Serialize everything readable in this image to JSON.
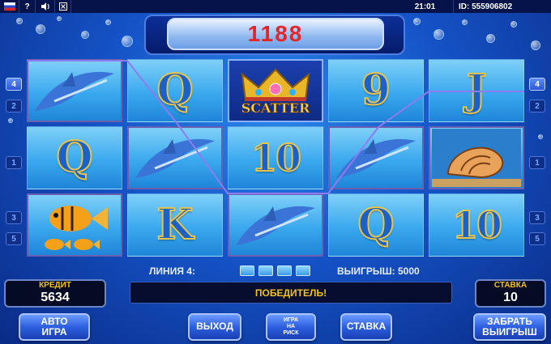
{
  "status_bar": {
    "help": "?",
    "sound_icon": "speaker-icon",
    "time": "21:01",
    "id_label": "ID: 555906802"
  },
  "win_amount": "1188",
  "reels": {
    "columns": [
      [
        "dolphin",
        "Q",
        "fish"
      ],
      [
        "Q",
        "dolphin",
        "K"
      ],
      [
        "scatter",
        "10",
        "dolphin"
      ],
      [
        "9",
        "dolphin",
        "Q"
      ],
      [
        "J",
        "shell",
        "10"
      ]
    ],
    "scatter_label": "SCATTER"
  },
  "line_indicators": {
    "left": [
      "4",
      "2",
      "1",
      "3",
      "5"
    ],
    "right": [
      "4",
      "2",
      "1",
      "3",
      "5"
    ]
  },
  "info": {
    "line_text": "ЛИНИЯ 4:",
    "win_text": "ВЫИГРЫШ: 5000"
  },
  "credit": {
    "label": "КРЕДИТ",
    "value": "5634"
  },
  "bet": {
    "label": "СТАВКА",
    "value": "10"
  },
  "message": "ПОБЕДИТЕЛЬ!",
  "buttons": {
    "auto_line1": "АВТО",
    "auto_line2": "ИГРА",
    "exit": "ВЫХОД",
    "risk_line1": "ИГРА",
    "risk_line2": "НА",
    "risk_line3": "РИСК",
    "bet": "СТАВКА",
    "collect_line1": "ЗАБРАТЬ",
    "collect_line2": "ВЫИГРЫШ"
  },
  "colors": {
    "win_digits": "#e3262b",
    "panel_label": "#f1c21b",
    "button_blue": "#2d5fe0"
  }
}
